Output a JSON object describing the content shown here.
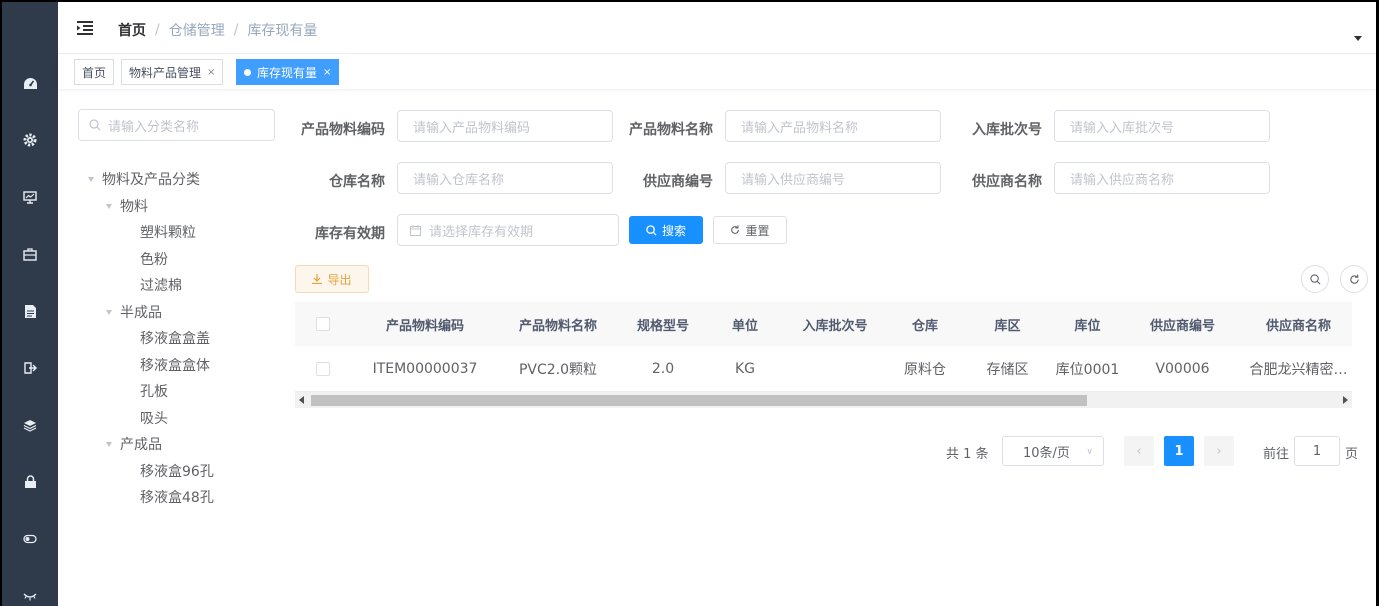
{
  "navbar": {
    "breadcrumb": [
      "首页",
      "仓储管理",
      "库存现有量"
    ],
    "separator": "/"
  },
  "tags": [
    {
      "label": "首页",
      "closable": false,
      "active": false
    },
    {
      "label": "物料产品管理",
      "closable": true,
      "active": false
    },
    {
      "label": "库存现有量",
      "closable": true,
      "active": true
    }
  ],
  "tag_close": "×",
  "tree": {
    "search_placeholder": "请输入分类名称",
    "nodes": [
      {
        "label": "物料及产品分类",
        "level": 0,
        "expanded": true
      },
      {
        "label": "物料",
        "level": 1,
        "expanded": true
      },
      {
        "label": "塑料颗粒",
        "level": 2
      },
      {
        "label": "色粉",
        "level": 2
      },
      {
        "label": "过滤棉",
        "level": 2
      },
      {
        "label": "半成品",
        "level": 1,
        "expanded": true
      },
      {
        "label": "移液盒盒盖",
        "level": 2
      },
      {
        "label": "移液盒盒体",
        "level": 2
      },
      {
        "label": "孔板",
        "level": 2
      },
      {
        "label": "吸头",
        "level": 2
      },
      {
        "label": "产成品",
        "level": 1,
        "expanded": true
      },
      {
        "label": "移液盒96孔",
        "level": 2
      },
      {
        "label": "移液盒48孔",
        "level": 2
      }
    ]
  },
  "filters": {
    "item_code": {
      "label": "产品物料编码",
      "placeholder": "请输入产品物料编码"
    },
    "item_name": {
      "label": "产品物料名称",
      "placeholder": "请输入产品物料名称"
    },
    "batch_code": {
      "label": "入库批次号",
      "placeholder": "请输入入库批次号"
    },
    "warehouse": {
      "label": "仓库名称",
      "placeholder": "请输入仓库名称"
    },
    "vendor_code": {
      "label": "供应商编号",
      "placeholder": "请输入供应商编号"
    },
    "vendor_name": {
      "label": "供应商名称",
      "placeholder": "请输入供应商名称"
    },
    "expire": {
      "label": "库存有效期",
      "placeholder": "请选择库存有效期"
    },
    "search_button": "搜索",
    "reset_button": "重置"
  },
  "toolbar": {
    "export_button": "导出"
  },
  "table": {
    "columns": [
      "产品物料编码",
      "产品物料名称",
      "规格型号",
      "单位",
      "入库批次号",
      "仓库",
      "库区",
      "库位",
      "供应商编号",
      "供应商名称"
    ],
    "rows": [
      [
        "ITEM00000037",
        "PVC2.0颗粒",
        "2.0",
        "KG",
        "",
        "原料仓",
        "存储区",
        "库位0001",
        "V00006",
        "合肥龙兴精密…"
      ]
    ]
  },
  "pagination": {
    "total": "共 1 条",
    "page_size": "10条/页",
    "prev": "‹",
    "current": "1",
    "next": "›",
    "goto_label": "前往",
    "goto_value": "1",
    "page_suffix": "页"
  },
  "colors": {
    "primary": "#1890ff",
    "sidebar": "#2f3b4b",
    "warning": "#e6a23c"
  }
}
